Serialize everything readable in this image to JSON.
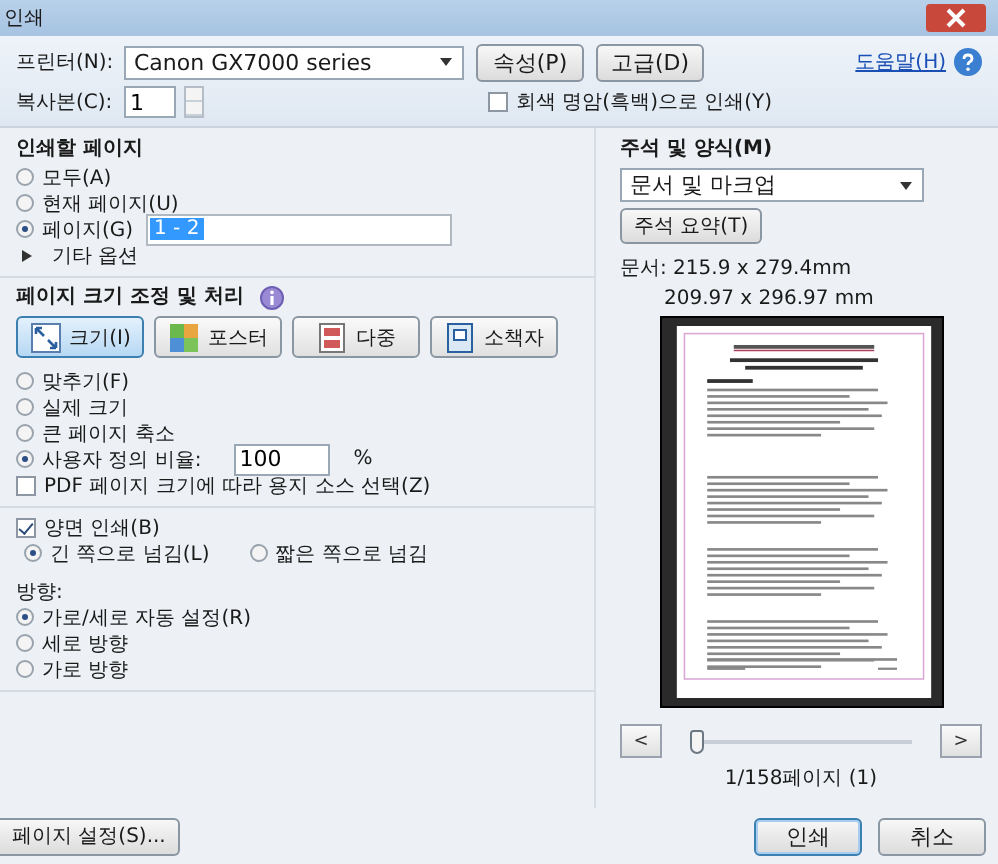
{
  "window": {
    "title": "인쇄"
  },
  "top": {
    "printer_label": "프린터(N):",
    "printer": "Canon GX7000 series",
    "buttons": [
      "속성(P)",
      "고급(D)"
    ],
    "help_link": "도움말(H)",
    "copies_label": "복사본(C):",
    "copies": "1",
    "grayscale": {
      "label": "회색 명암(흑백)으로 인쇄(Y)",
      "checked": false
    }
  },
  "pages_to_print": {
    "title": "인쇄할 페이지",
    "options": [
      {
        "label": "모두(A)",
        "selected": false
      },
      {
        "label": "현재 페이지(U)",
        "selected": false
      },
      {
        "label": "페이지(G)",
        "selected": true
      }
    ],
    "range": "1 - 2",
    "more_options": {
      "label": "기타 옵션",
      "expanded": false
    }
  },
  "sizing": {
    "title": "페이지 크기 조정 및 처리",
    "modes": [
      {
        "label": "크기(I)",
        "selected": true
      },
      {
        "label": "포스터",
        "selected": false
      },
      {
        "label": "다중",
        "selected": false
      },
      {
        "label": "소책자",
        "selected": false
      }
    ],
    "options": [
      {
        "label": "맞추기(F)",
        "selected": false
      },
      {
        "label": "실제 크기",
        "selected": false
      },
      {
        "label": "큰 페이지 축소",
        "selected": false
      },
      {
        "label": "사용자 정의 비율:",
        "selected": true,
        "value": "100",
        "unit": "%"
      }
    ],
    "paper_source": {
      "label": "PDF 페이지 크기에 따라 용지 소스 선택(Z)",
      "checked": false
    }
  },
  "duplex": {
    "label": "양면 인쇄(B)",
    "checked": true,
    "options": [
      {
        "label": "긴 쪽으로 넘김(L)",
        "selected": true
      },
      {
        "label": "짧은 쪽으로 넘김",
        "selected": false
      }
    ]
  },
  "orientation": {
    "title": "방향:",
    "options": [
      {
        "label": "가로/세로 자동 설정(R)",
        "selected": true
      },
      {
        "label": "세로 방향",
        "selected": false
      },
      {
        "label": "가로 방향",
        "selected": false
      }
    ]
  },
  "page_setup_button": "페이지 설정(S)...",
  "comments": {
    "title": "주석 및 양식(M)",
    "value": "문서 및 마크업",
    "summary_button": "주석 요약(T)",
    "document_size": "문서: 215.9 x 279.4mm",
    "paper_size": "209.97 x 296.97 mm"
  },
  "navigation": {
    "prev": "<",
    "next": ">",
    "level": 0,
    "page_count": "1/158페이지 (1)"
  },
  "actions": [
    "인쇄",
    "취소"
  ]
}
